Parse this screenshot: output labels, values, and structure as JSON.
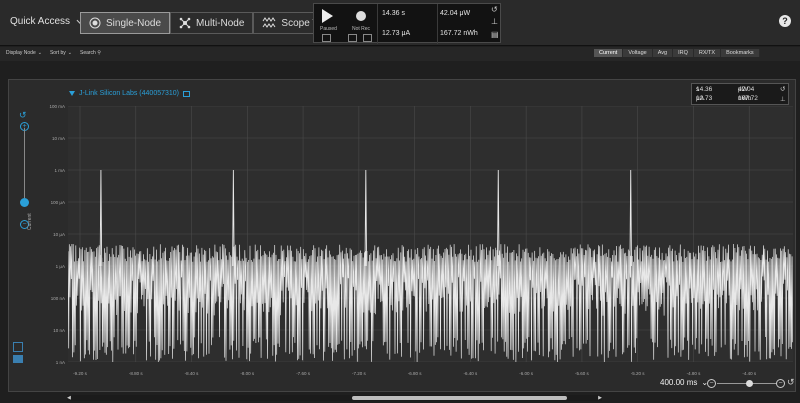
{
  "toolbar": {
    "quick_access": "Quick Access",
    "modes": [
      {
        "label": "Single-Node",
        "icon": "single-node-icon",
        "active": true
      },
      {
        "label": "Multi-Node",
        "icon": "multi-node-icon",
        "active": false
      },
      {
        "label": "Scope View",
        "icon": "scope-view-icon",
        "active": false
      }
    ],
    "help_label": "?"
  },
  "recording": {
    "paused_label": "Paused",
    "not_rec_label": "Not Rec",
    "time_value": "14.36",
    "time_unit": "s",
    "current_value": "12.73",
    "current_unit": "μA",
    "power_value": "42.04",
    "power_unit": "μW",
    "energy_value": "167.72",
    "energy_unit": "nWh"
  },
  "subbar": {
    "display_node": "Display Node",
    "sort_by": "Sort by",
    "search": "Search"
  },
  "view_tabs": [
    "Current",
    "Voltage",
    "Avg",
    "IRQ",
    "RX/TX",
    "Bookmarks"
  ],
  "active_tab": "Current",
  "panel": {
    "device_name": "J-Link Silicon Labs (440057310)",
    "y_axis_label": "Current",
    "mini_time": "14.36",
    "mini_time_unit": "s",
    "mini_current": "12.73",
    "mini_current_unit": "μA",
    "mini_power": "42.04",
    "mini_power_unit": "μW",
    "mini_energy": "167.72",
    "mini_energy_unit": "nWh"
  },
  "timebase": "400.00 ms",
  "colors": {
    "accent": "#2a9fd8",
    "trace": "#e8e8e8",
    "panel_bg": "#2e2e2e"
  },
  "chart_data": {
    "type": "line",
    "title": "",
    "xlabel": "",
    "ylabel": "Current",
    "y_scale": "log",
    "y_tick_labels": [
      "100 mA",
      "10 mA",
      "1 mA",
      "100 μA",
      "10 μA",
      "1 μA",
      "100 nA",
      "10 nA",
      "1 nA"
    ],
    "x_tick_labels": [
      "-9.20 s",
      "-8.80 s",
      "-8.40 s",
      "-8.00 s",
      "-7.60 s",
      "-7.20 s",
      "-6.80 s",
      "-6.40 s",
      "-6.00 s",
      "-5.60 s",
      "-5.20 s",
      "-4.80 s",
      "-4.40 s",
      "-4.00 s"
    ],
    "spikes": [
      {
        "x": "-9.05 s",
        "peak": "1 mA"
      },
      {
        "x": "-8.10 s",
        "peak": "1 mA"
      },
      {
        "x": "-7.15 s",
        "peak": "1 mA"
      },
      {
        "x": "-6.20 s",
        "peak": "1 mA"
      },
      {
        "x": "-5.25 s",
        "peak": "1 mA"
      }
    ],
    "baseline": "~1 μA with dense noise down to ~1 nA",
    "grid": true
  }
}
